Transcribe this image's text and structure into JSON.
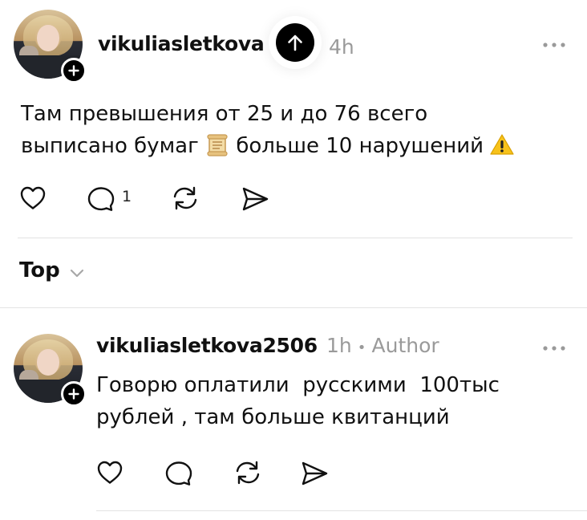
{
  "post": {
    "username": "vikuliasletkova",
    "time": "4h",
    "text_line1": "Там превышения от 25 и до 76 всего",
    "text_line2_a": "выписано бумаг",
    "text_line2_b": "больше 10 нарушений",
    "reply_count": "1",
    "emojis": [
      "scroll-emoji",
      "warning-emoji"
    ]
  },
  "sort": {
    "label": "Top"
  },
  "reply": {
    "username": "vikuliasletkova2506",
    "time": "1h",
    "separator": "•",
    "author_tag": "Author",
    "text_line1": "Говорю оплатили  русскими  100тыс",
    "text_line2": "рублей , там больше квитанций"
  },
  "icons": {
    "more": "more-icon",
    "like": "heart-icon",
    "comment": "comment-icon",
    "repost": "repost-icon",
    "share": "share-icon",
    "follow": "plus-icon",
    "scroll_top": "arrow-up-icon",
    "sort_toggle": "chevron-down-icon"
  },
  "colors": {
    "text": "#101010",
    "muted": "#9a9a9a",
    "divider": "#e3e3e3",
    "accent": "#000000"
  }
}
